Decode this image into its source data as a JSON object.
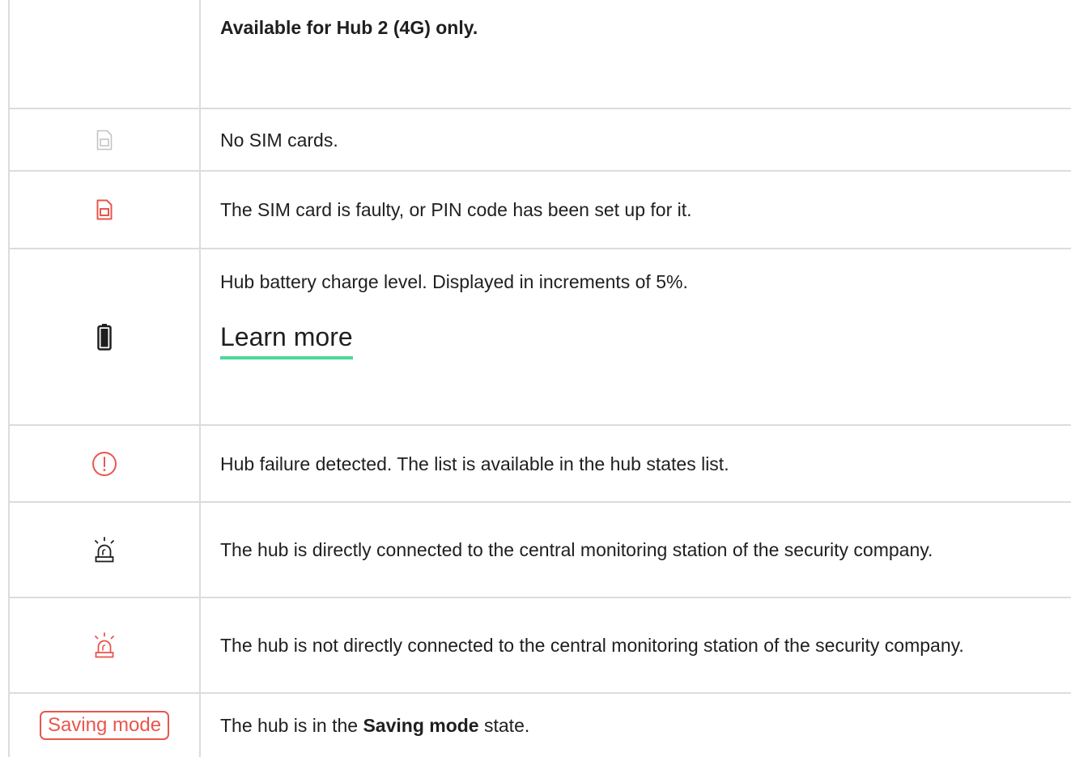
{
  "rows": [
    {
      "text": "Available for Hub 2 (4G) only."
    },
    {
      "icon": "sim-card-empty-icon",
      "text": "No SIM cards."
    },
    {
      "icon": "sim-card-error-icon",
      "text": "The SIM card is faulty, or PIN code has been set up for it."
    },
    {
      "icon": "battery-icon",
      "text": "Hub battery charge level. Displayed in increments of 5%.",
      "link": "Learn more"
    },
    {
      "icon": "exclamation-circle-icon",
      "text": "Hub failure detected. The list is available in the hub states list."
    },
    {
      "icon": "siren-icon",
      "text": "The hub is directly connected to the central monitoring station of the security company."
    },
    {
      "icon": "siren-red-icon",
      "text": "The hub is not directly connected to the central monitoring station of the security company."
    },
    {
      "badge": "Saving mode",
      "text_pre": "The hub is in the ",
      "text_bold": "Saving mode",
      "text_post": " state."
    }
  ],
  "colors": {
    "accent_red": "#e8564d",
    "link_underline": "#4fd69c",
    "grey_icon": "#bdbdbd",
    "border": "#dcdcdc"
  }
}
